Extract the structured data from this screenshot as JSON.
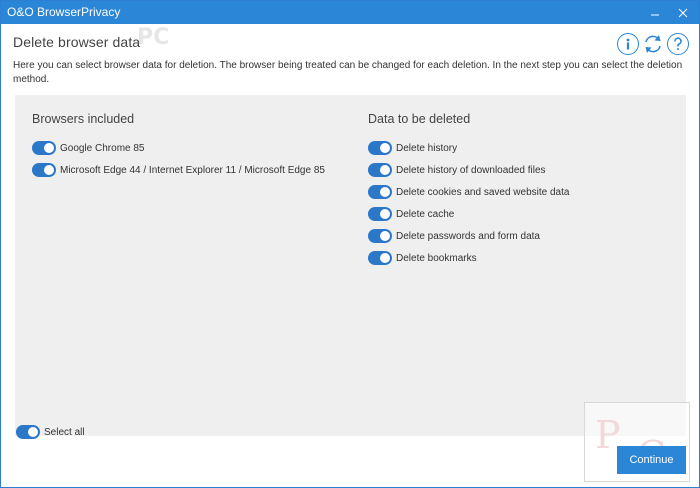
{
  "window": {
    "title": "O&O BrowserPrivacy",
    "minimize_icon": "minimize-icon",
    "close_icon": "close-icon"
  },
  "header": {
    "page_title": "Delete browser data",
    "watermark_text": "PC",
    "description": "Here you can select browser data for deletion. The browser being treated can be changed for each deletion. In the next step you can select the deletion method.",
    "icons": [
      "info-icon",
      "refresh-icon",
      "help-icon"
    ]
  },
  "browsers": {
    "heading": "Browsers included",
    "items": [
      {
        "label": "Google Chrome 85",
        "checked": true
      },
      {
        "label": "Microsoft Edge 44 / Internet Explorer 11 / Microsoft Edge 85",
        "checked": true
      }
    ]
  },
  "data_to_delete": {
    "heading": "Data to be deleted",
    "items": [
      {
        "label": "Delete history",
        "checked": true
      },
      {
        "label": "Delete history of downloaded files",
        "checked": true
      },
      {
        "label": "Delete cookies and saved website data",
        "checked": true
      },
      {
        "label": "Delete cache",
        "checked": true
      },
      {
        "label": "Delete passwords and form data",
        "checked": true
      },
      {
        "label": "Delete bookmarks",
        "checked": true
      }
    ]
  },
  "select_all": {
    "label": "Select all",
    "checked": true
  },
  "footer": {
    "continue_label": "Continue"
  },
  "colors": {
    "accent": "#2b86d8",
    "toggle_on": "#2b78c8",
    "panel_bg": "#efefef"
  }
}
